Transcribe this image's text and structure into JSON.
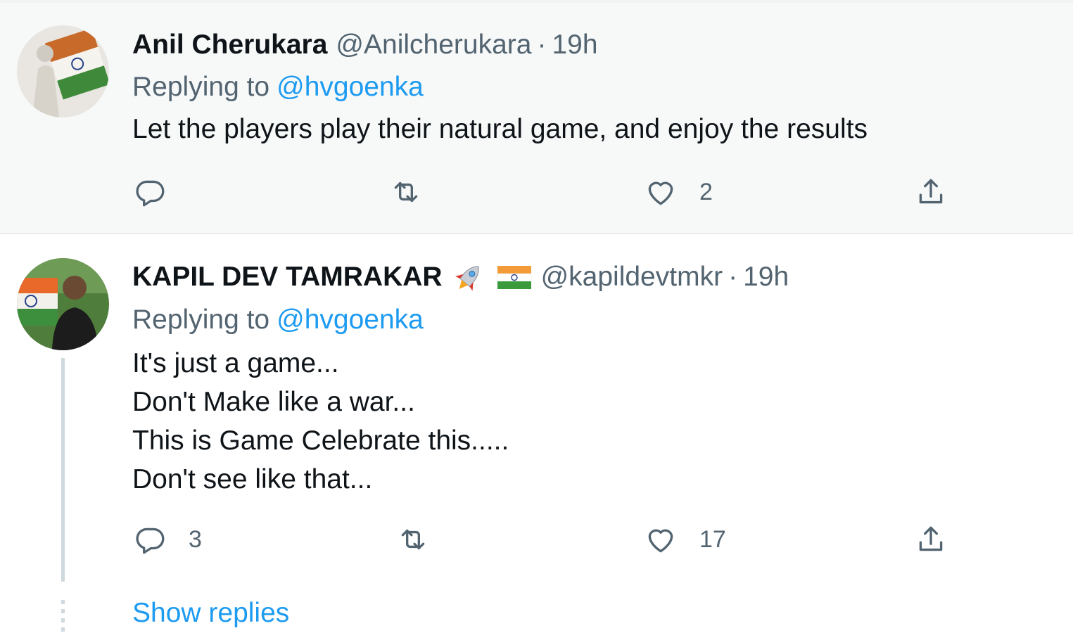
{
  "tweets": [
    {
      "display_name": "Anil Cherukara",
      "handle": "@Anilcherukara",
      "separator": "·",
      "time": "19h",
      "replying_label": "Replying to",
      "replying_to": "@hvgoenka",
      "text_lines": [
        "Let the players play their natural game, and enjoy the results"
      ],
      "reply_count": "",
      "retweet_count": "",
      "like_count": "2"
    },
    {
      "display_name": "KAPIL DEV TAMRAKAR",
      "name_emojis": [
        "rocket-emoji",
        "india-flag-emoji"
      ],
      "handle": "@kapildevtmkr",
      "separator": "·",
      "time": "19h",
      "replying_label": "Replying to",
      "replying_to": "@hvgoenka",
      "text_lines": [
        "It's just a game...",
        "Don't Make like a war...",
        "This is Game Celebrate this.....",
        "Don't see like that..."
      ],
      "reply_count": "3",
      "retweet_count": "",
      "like_count": "17"
    }
  ],
  "show_replies_label": "Show replies",
  "icons": {
    "reply": "reply-icon",
    "retweet": "retweet-icon",
    "like": "like-icon",
    "share": "share-icon"
  },
  "colors": {
    "accent": "#1d9bf0",
    "secondary_text": "#536471",
    "primary_text": "#0f1419",
    "highlight_bg": "#f7f9f9",
    "thread_line": "#cfd9de"
  }
}
